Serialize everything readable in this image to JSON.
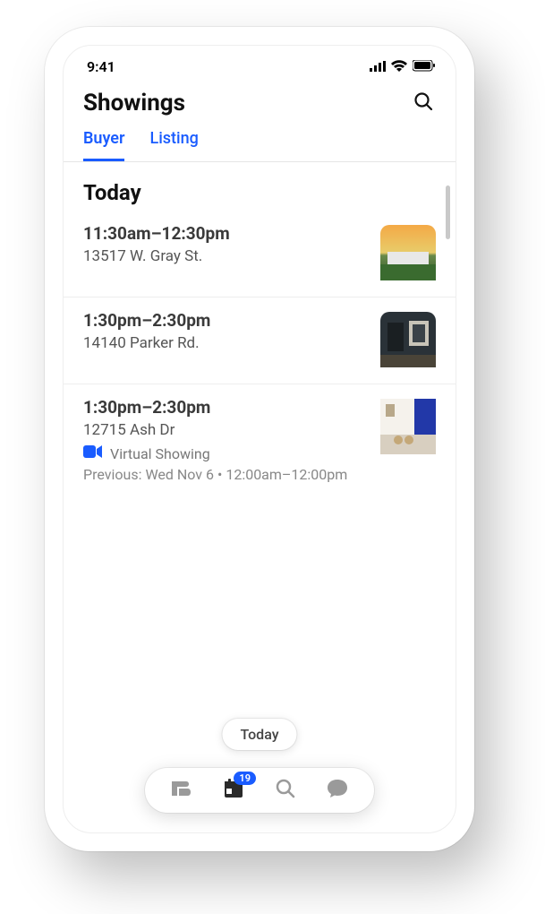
{
  "status_bar": {
    "time": "9:41"
  },
  "header": {
    "title": "Showings"
  },
  "tabs": [
    {
      "label": "Buyer",
      "active": true
    },
    {
      "label": "Listing",
      "active": false
    }
  ],
  "sections": {
    "today": {
      "header": "Today",
      "items": [
        {
          "time": "11:30am–12:30pm",
          "address": "13517 W. Gray St."
        },
        {
          "time": "1:30pm–2:30pm",
          "address": "14140 Parker Rd."
        },
        {
          "time": "1:30pm–2:30pm",
          "address": "12715 Ash Dr",
          "virtual_label": "Virtual Showing",
          "previous": "Previous: Wed Nov 6 • 12:00am–12:00pm"
        }
      ]
    }
  },
  "today_chip": "Today",
  "bottom_nav": {
    "calendar_badge": "19"
  },
  "colors": {
    "accent": "#1a5cff"
  }
}
